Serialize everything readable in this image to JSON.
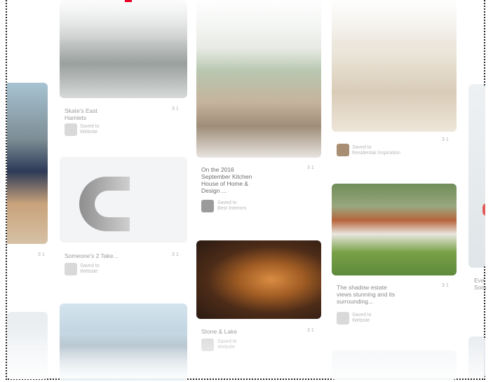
{
  "brand_color": "#e60023",
  "pins": {
    "p1": {
      "title_l1": "Skate's East",
      "title_l2": "Hamlets",
      "by": "Saved to",
      "board": "Website",
      "count": "3 1"
    },
    "p2": {
      "title": "Someone's 2 Take...",
      "by": "Saved to",
      "board": "Website",
      "count": "3 1"
    },
    "p3": {
      "title_l1": "On the 2016",
      "title_l2": "September Kitchen",
      "title_l3": "House of Home &",
      "title_l4": "Design ...",
      "by": "Saved to",
      "board": "Best Interiors",
      "count": "3 1"
    },
    "p4": {
      "title": "Stone & Lake",
      "by": "Saved to",
      "board": "Website",
      "count": "3 1"
    },
    "p5": {
      "by": "Saved to",
      "board": "Residential Inspiration",
      "count": "3 1"
    },
    "p6": {
      "title_l1": "The shadow estate",
      "title_l2": "views stunning and its",
      "title_l3": "surrounding...",
      "by": "Saved to",
      "board": "Website",
      "count": "3 1"
    },
    "p7": {
      "title_l1": "Eve",
      "title_l2": "Som"
    }
  },
  "left_count": "3 1"
}
